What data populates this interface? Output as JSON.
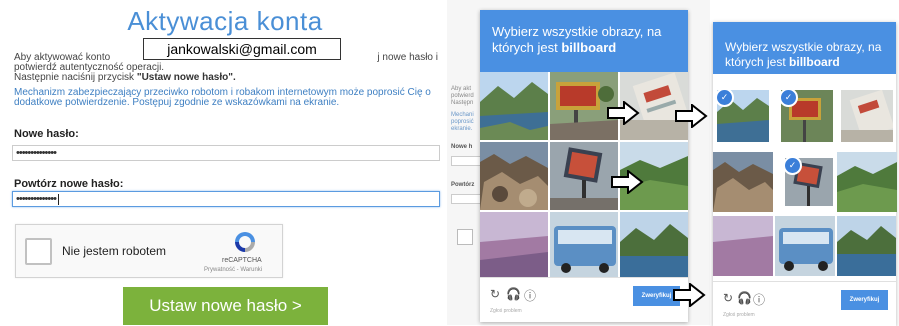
{
  "form": {
    "title": "Aktywacja konta",
    "email_overlay": "jankowalski@gmail.com",
    "intro_part1": "Aby aktywować konto",
    "intro_part2": "j nowe hasło i",
    "intro_line2": "potwierdź autentyczność operacji.",
    "intro_line3_prefix": "Następnie naciśnij przycisk ",
    "intro_line3_button_ref": "\"Ustaw nowe hasło\".",
    "security_text": "Mechanizm zabezpieczający przeciwko robotom i robakom internetowym może poprosić Cię o dodatkowe potwierdzenie. Postępuj zgodnie ze wskazówkami na ekranie.",
    "new_password_label": "Nowe hasło:",
    "new_password_value": "••••••••••••••",
    "repeat_password_label": "Powtórz nowe hasło:",
    "repeat_password_value": "••••••••••••••",
    "submit_label": "Ustaw nowe hasło >"
  },
  "recaptcha": {
    "checkbox_label": "Nie jestem robotem",
    "brand": "reCAPTCHA",
    "links": "Prywatność - Warunki"
  },
  "background_form": {
    "lines": [
      "Aby akt",
      "potwierd",
      "Następn"
    ],
    "blue_lines": [
      "Mechani",
      "poprosić",
      "ekranie."
    ],
    "label1": "Nowe h",
    "label2": "Powtórz"
  },
  "captcha1": {
    "instruction_prefix": "Wybierz wszystkie obrazy, na których jest ",
    "instruction_keyword": "billboard",
    "verify_label": "Zweryfikuj",
    "report_label": "Zgłoś problem"
  },
  "captcha2": {
    "instruction_prefix": "Wybierz wszystkie obrazy, na których jest ",
    "instruction_keyword": "billboard",
    "verify_label": "Zweryfikuj",
    "report_label": "Zgłoś problem",
    "selected_tiles": [
      0,
      1,
      3
    ]
  },
  "icons": {
    "reload": "reload-icon",
    "audio": "headphones-icon",
    "info": "info-icon"
  },
  "colors": {
    "accent_blue": "#4a90e2",
    "title_blue": "#4a8fd6",
    "submit_green": "#7cb23c"
  }
}
